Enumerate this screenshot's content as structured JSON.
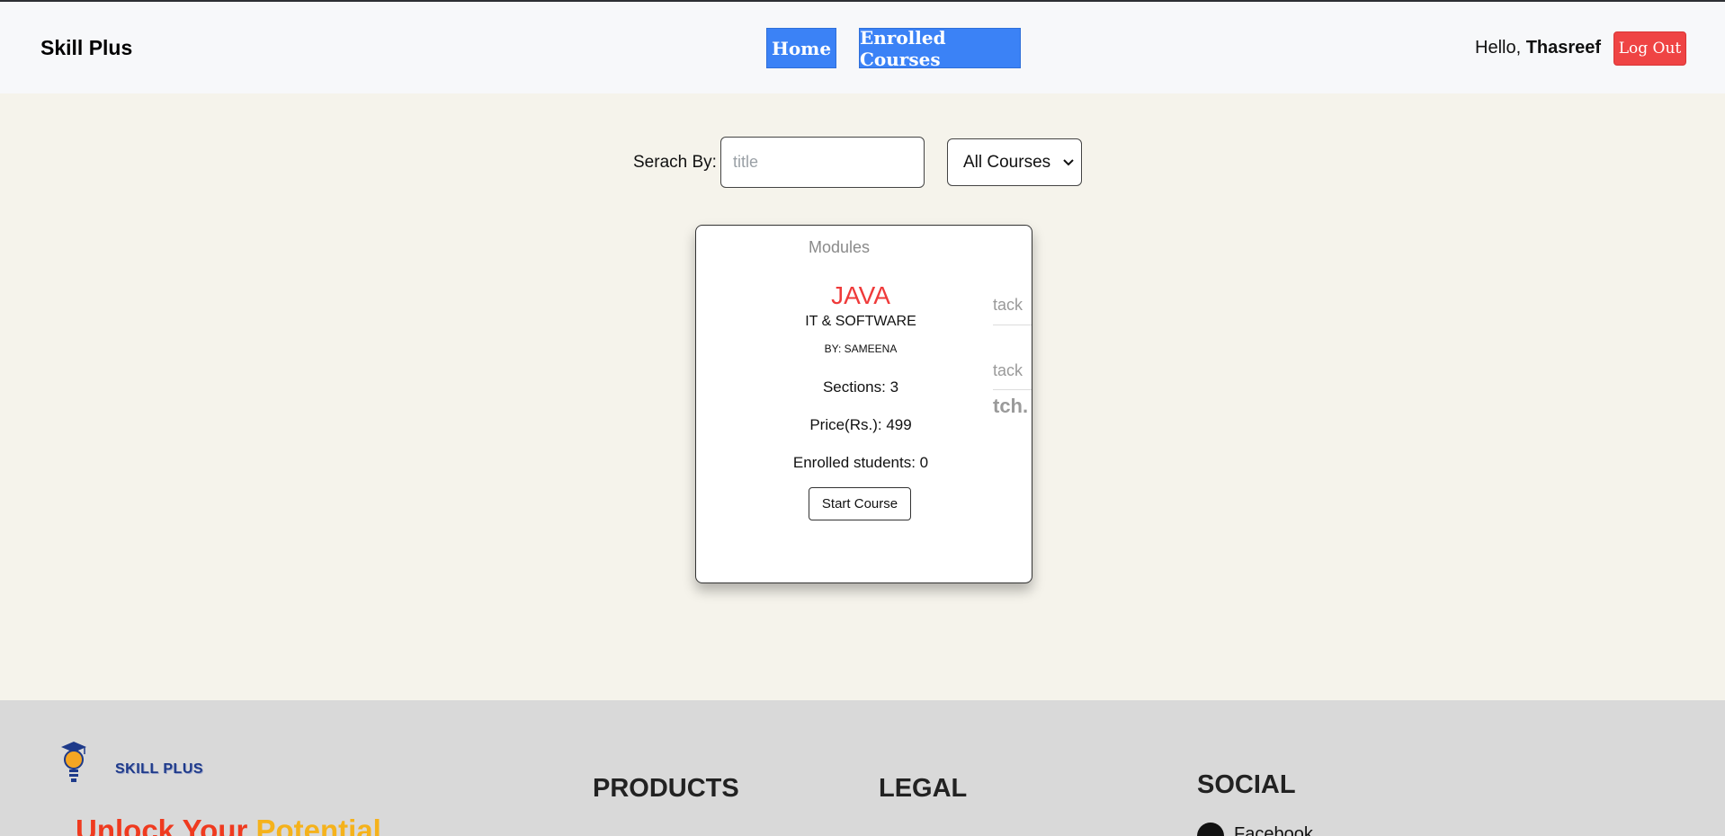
{
  "header": {
    "brand": "Skill Plus",
    "nav": {
      "home": "Home",
      "enrolled": "Enrolled Courses"
    },
    "greeting_prefix": "Hello,",
    "user_name": "Thasreef",
    "logout": "Log Out"
  },
  "search": {
    "label": "Serach By:",
    "placeholder": "title",
    "filter_selected": "All Courses"
  },
  "course_card": {
    "modules_label": "Modules",
    "title": "JAVA",
    "category": "IT & SOFTWARE",
    "by": "BY: SAMEENA",
    "sections": "Sections: 3",
    "price": "Price(Rs.): 499",
    "enrolled": "Enrolled students: 0",
    "start_button": "Start Course",
    "peek_text_1": "tack",
    "peek_text_2": "tack",
    "peek_text_3": "tch."
  },
  "footer": {
    "logo_text": "SKILL PLUS",
    "tagline_part1": "Unlock Your",
    "tagline_part2": "Potential",
    "products_heading": "PRODUCTS",
    "legal_heading": "LEGAL",
    "social_heading": "SOCIAL",
    "social_first": "Facebook"
  },
  "colors": {
    "nav_button": "#3b82f6",
    "logout_button": "#ef4444",
    "course_title": "#ef3a3a",
    "page_background": "#f5f3eb",
    "footer_background": "#d9d9d9"
  },
  "icons": [
    "chevron-down-icon",
    "skill-plus-logo-icon",
    "facebook-icon"
  ]
}
